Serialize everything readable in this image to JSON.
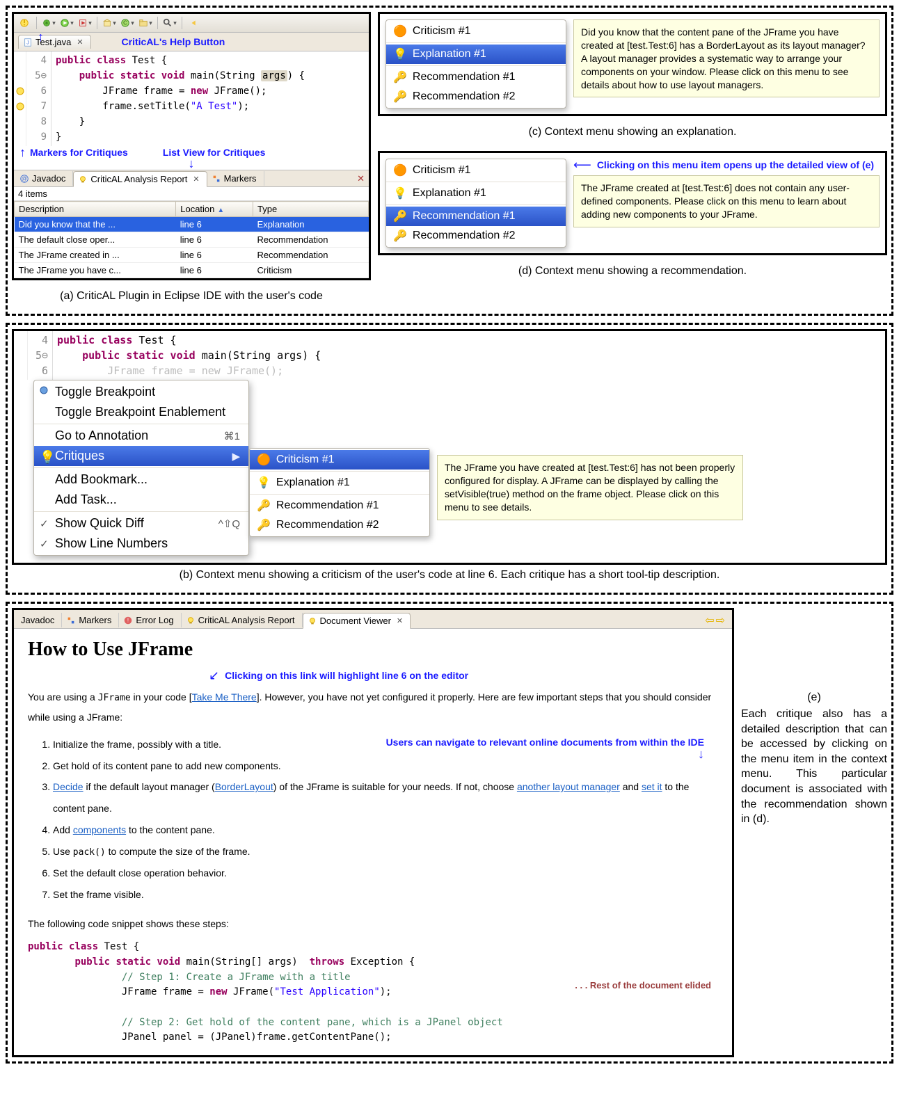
{
  "annotations": {
    "help_btn": "CriticAL's Help Button",
    "markers": "Markers for Critiques",
    "listview": "List View for Critiques",
    "d_click": "Clicking on this menu item opens up the detailed view of (e)",
    "e_link": "Clicking on this link will highlight line 6 on the editor",
    "e_nav": "Users can navigate to relevant online documents from within the IDE"
  },
  "captions": {
    "a": "(a) CriticAL Plugin in Eclipse IDE with the user's code",
    "b": "(b) Context menu showing a criticism of the user's code at line 6. Each critique has a short tool-tip description.",
    "c": "(c) Context menu showing an explanation.",
    "d": "(d) Context menu showing a recommendation.",
    "e_label": "(e)",
    "e_text": "Each critique also has a detailed description that can be accessed by clicking on the menu item in the context menu. This particular document is associated with the recommendation shown in (d)."
  },
  "panel_a": {
    "filetab": "Test.java",
    "code_lines": [
      {
        "n": "4",
        "txt_parts": [
          {
            "t": "public class ",
            "c": "kw"
          },
          {
            "t": "Test {"
          }
        ]
      },
      {
        "n": "5",
        "fold": true,
        "txt_parts": [
          {
            "t": "    "
          },
          {
            "t": "public static void ",
            "c": "kw"
          },
          {
            "t": "main(String "
          },
          {
            "t": "args",
            "c": "hlarg"
          },
          {
            "t": ") {"
          }
        ]
      },
      {
        "n": "6",
        "txt_parts": [
          {
            "t": "        JFrame frame = "
          },
          {
            "t": "new ",
            "c": "kw"
          },
          {
            "t": "JFrame();"
          }
        ]
      },
      {
        "n": "7",
        "txt_parts": [
          {
            "t": "        frame.setTitle("
          },
          {
            "t": "\"A Test\"",
            "c": "str"
          },
          {
            "t": ");"
          }
        ]
      },
      {
        "n": "8",
        "txt_parts": [
          {
            "t": "    }"
          }
        ]
      },
      {
        "n": "9",
        "txt_parts": [
          {
            "t": "}"
          }
        ]
      }
    ],
    "view_tabs": {
      "javadoc": "Javadoc",
      "report": "CriticAL Analysis Report",
      "markers": "Markers"
    },
    "items_count": "4 items",
    "columns": {
      "desc": "Description",
      "loc": "Location",
      "type": "Type"
    },
    "rows": [
      {
        "desc": "Did you know that the ...",
        "loc": "line 6",
        "type": "Explanation",
        "sel": true
      },
      {
        "desc": "The default close oper...",
        "loc": "line 6",
        "type": "Recommendation"
      },
      {
        "desc": "The JFrame created in ...",
        "loc": "line 6",
        "type": "Recommendation"
      },
      {
        "desc": "The JFrame you have c...",
        "loc": "line 6",
        "type": "Criticism"
      }
    ]
  },
  "critique_menu_items": {
    "c1": "Criticism #1",
    "e1": "Explanation #1",
    "r1": "Recommendation #1",
    "r2": "Recommendation #2"
  },
  "panel_c": {
    "tooltip": "Did you know that the content pane of the JFrame you have created at [test.Test:6] has a BorderLayout as its layout manager? A layout manager provides a systematic way to arrange your components on your window. Please click on this menu to see details about how to use layout managers."
  },
  "panel_d": {
    "tooltip": "The JFrame created at [test.Test:6] does not contain any user-defined components. Please click on this menu to learn about adding new components to your JFrame."
  },
  "panel_b": {
    "code_lines": [
      {
        "n": "4",
        "txt_parts": [
          {
            "t": "public class ",
            "c": "kw"
          },
          {
            "t": "Test {"
          }
        ]
      },
      {
        "n": "5",
        "fold": true,
        "txt_parts": [
          {
            "t": "    "
          },
          {
            "t": "public static void ",
            "c": "kw"
          },
          {
            "t": "main(String args) {"
          }
        ]
      },
      {
        "n": "6",
        "txt_parts": [
          {
            "t": "        JFrame frame = new JFrame();"
          }
        ],
        "faded": true
      }
    ],
    "ctx": {
      "toggle_bp": "Toggle Breakpoint",
      "toggle_en": "Toggle Breakpoint Enablement",
      "go_anno": "Go to Annotation",
      "go_anno_sc": "⌘1",
      "critiques": "Critiques",
      "add_bm": "Add Bookmark...",
      "add_task": "Add Task...",
      "quick_diff": "Show Quick Diff",
      "quick_diff_sc": "^⇧Q",
      "line_nums": "Show Line Numbers"
    },
    "tooltip": "The JFrame you have created at [test.Test:6] has not been properly configured for display. A JFrame can be displayed by calling the setVisible(true) method on the frame object. Please click on this menu to see details."
  },
  "panel_e": {
    "tabs": {
      "javadoc": "Javadoc",
      "markers": "Markers",
      "errorlog": "Error Log",
      "report": "CriticAL Analysis Report",
      "docviewer": "Document Viewer"
    },
    "h1": "How to Use JFrame",
    "p1_a": "You are using a ",
    "p1_code": "JFrame",
    "p1_b": " in your code [",
    "p1_link": "Take Me There",
    "p1_c": "]. However, you have not yet configured it properly. Here are few important steps that you should consider while using a JFrame:",
    "steps": [
      {
        "parts": [
          {
            "t": "Initialize the frame, possibly with a title."
          }
        ]
      },
      {
        "parts": [
          {
            "t": "Get hold of its content pane to add new components."
          }
        ]
      },
      {
        "parts": [
          {
            "t": "Decide",
            "link": true
          },
          {
            "t": " if the default layout manager ("
          },
          {
            "t": "BorderLayout",
            "link": true
          },
          {
            "t": ") of the JFrame is suitable for your needs. If not, choose "
          },
          {
            "t": "another layout manager",
            "link": true
          },
          {
            "t": " and "
          },
          {
            "t": "set it",
            "link": true
          },
          {
            "t": " to the content pane."
          }
        ]
      },
      {
        "parts": [
          {
            "t": "Add "
          },
          {
            "t": "components",
            "link": true
          },
          {
            "t": " to the content pane."
          }
        ]
      },
      {
        "parts": [
          {
            "t": "Use "
          },
          {
            "t": "pack()",
            "mono": true
          },
          {
            "t": " to compute the size of the frame."
          }
        ]
      },
      {
        "parts": [
          {
            "t": "Set the default close operation behavior."
          }
        ]
      },
      {
        "parts": [
          {
            "t": "Set the frame visible."
          }
        ]
      }
    ],
    "p2": "The following code snippet shows these steps:",
    "snippet": [
      {
        "parts": [
          {
            "t": "public class ",
            "c": "kw"
          },
          {
            "t": "Test {"
          }
        ]
      },
      {
        "parts": [
          {
            "t": "        "
          },
          {
            "t": "public static void ",
            "c": "kw"
          },
          {
            "t": "main(String[] args)  "
          },
          {
            "t": "throws ",
            "c": "kw"
          },
          {
            "t": "Exception {"
          }
        ]
      },
      {
        "parts": [
          {
            "t": "                "
          },
          {
            "t": "// Step 1: Create a JFrame with a title",
            "c": "cmnt"
          }
        ]
      },
      {
        "parts": [
          {
            "t": "                JFrame frame = "
          },
          {
            "t": "new ",
            "c": "kw"
          },
          {
            "t": "JFrame("
          },
          {
            "t": "\"Test Application\"",
            "c": "str"
          },
          {
            "t": ");"
          }
        ]
      },
      {
        "parts": [
          {
            "t": " "
          }
        ]
      },
      {
        "parts": [
          {
            "t": "                "
          },
          {
            "t": "// Step 2: Get hold of the content pane, which is a JPanel object",
            "c": "cmnt"
          }
        ]
      },
      {
        "parts": [
          {
            "t": "                JPanel panel = (JPanel)frame.getContentPane();"
          }
        ]
      }
    ],
    "elided": ". . . Rest of the document elided"
  }
}
